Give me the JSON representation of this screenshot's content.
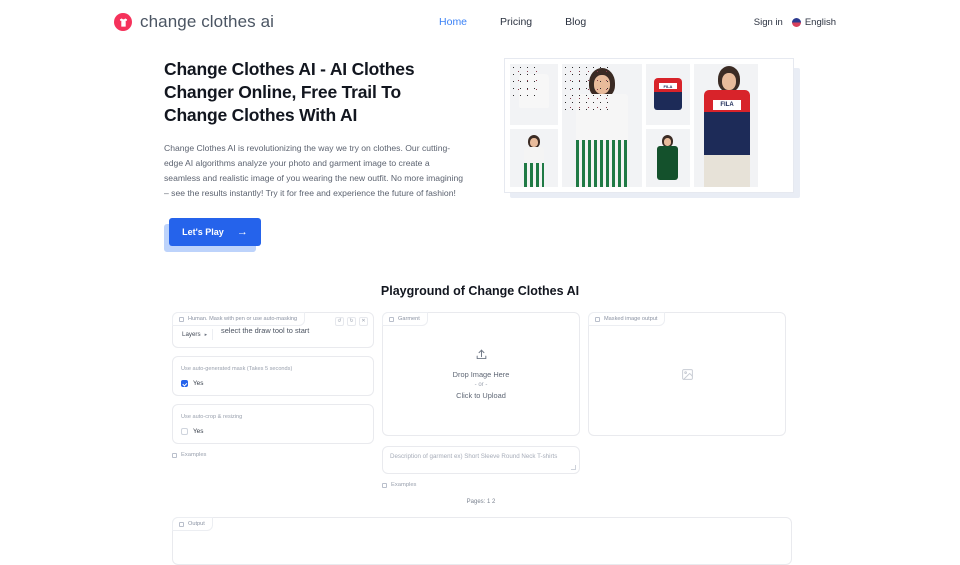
{
  "header": {
    "brand": "change clothes ai",
    "logo_icon": "tshirt-icon",
    "logo_color": "#f5325b",
    "nav": [
      {
        "label": "Home",
        "active": true
      },
      {
        "label": "Pricing",
        "active": false
      },
      {
        "label": "Blog",
        "active": false
      }
    ],
    "signin": "Sign in",
    "language": "English",
    "active_color": "#3b82f6"
  },
  "hero": {
    "title": "Change Clothes AI - AI Clothes Changer Online, Free Trail To Change Clothes With AI",
    "paragraph": "Change Clothes AI is revolutionizing the way we try on clothes. Our cutting-edge AI algorithms analyze your photo and garment image to create a seamless and realistic image of you wearing the new outfit. No more imagining – see the results instantly! Try it for free and experience the future of fashion!",
    "cta_label": "Let's Play",
    "cta_arrow": "→",
    "cta_color": "#2563eb"
  },
  "playground": {
    "title": "Playground of Change Clothes AI",
    "human_panel": {
      "tag": "Human. Mask with pen or use auto-masking",
      "hint": "select the draw tool to start",
      "layers_label": "Layers",
      "layers_caret": "▸",
      "tools": [
        {
          "name": "undo-icon",
          "glyph": "↺"
        },
        {
          "name": "redo-icon",
          "glyph": "↻"
        },
        {
          "name": "clear-icon",
          "glyph": "✕"
        }
      ]
    },
    "options": [
      {
        "label": "Use auto-generated mask (Takes 5 seconds)",
        "value": "Yes",
        "checked": true
      },
      {
        "label": "Use auto-crop & resizing",
        "value": "Yes",
        "checked": false
      }
    ],
    "examples_label": "Examples",
    "garment_panel": {
      "tag": "Garment",
      "drop_line1": "Drop Image Here",
      "drop_or": "- or -",
      "drop_line2": "Click to Upload",
      "upload_icon": "upload-icon"
    },
    "description": {
      "placeholder": "Description of garment ex) Short Sleeve Round Neck T-shirts",
      "value": ""
    },
    "garment_examples_label": "Examples",
    "pages_label": "Pages:",
    "pages": [
      "1",
      "2"
    ],
    "masked_panel": {
      "tag": "Masked image output",
      "placeholder_icon": "image-placeholder-icon"
    },
    "output_panel": {
      "tag": "Output"
    }
  }
}
